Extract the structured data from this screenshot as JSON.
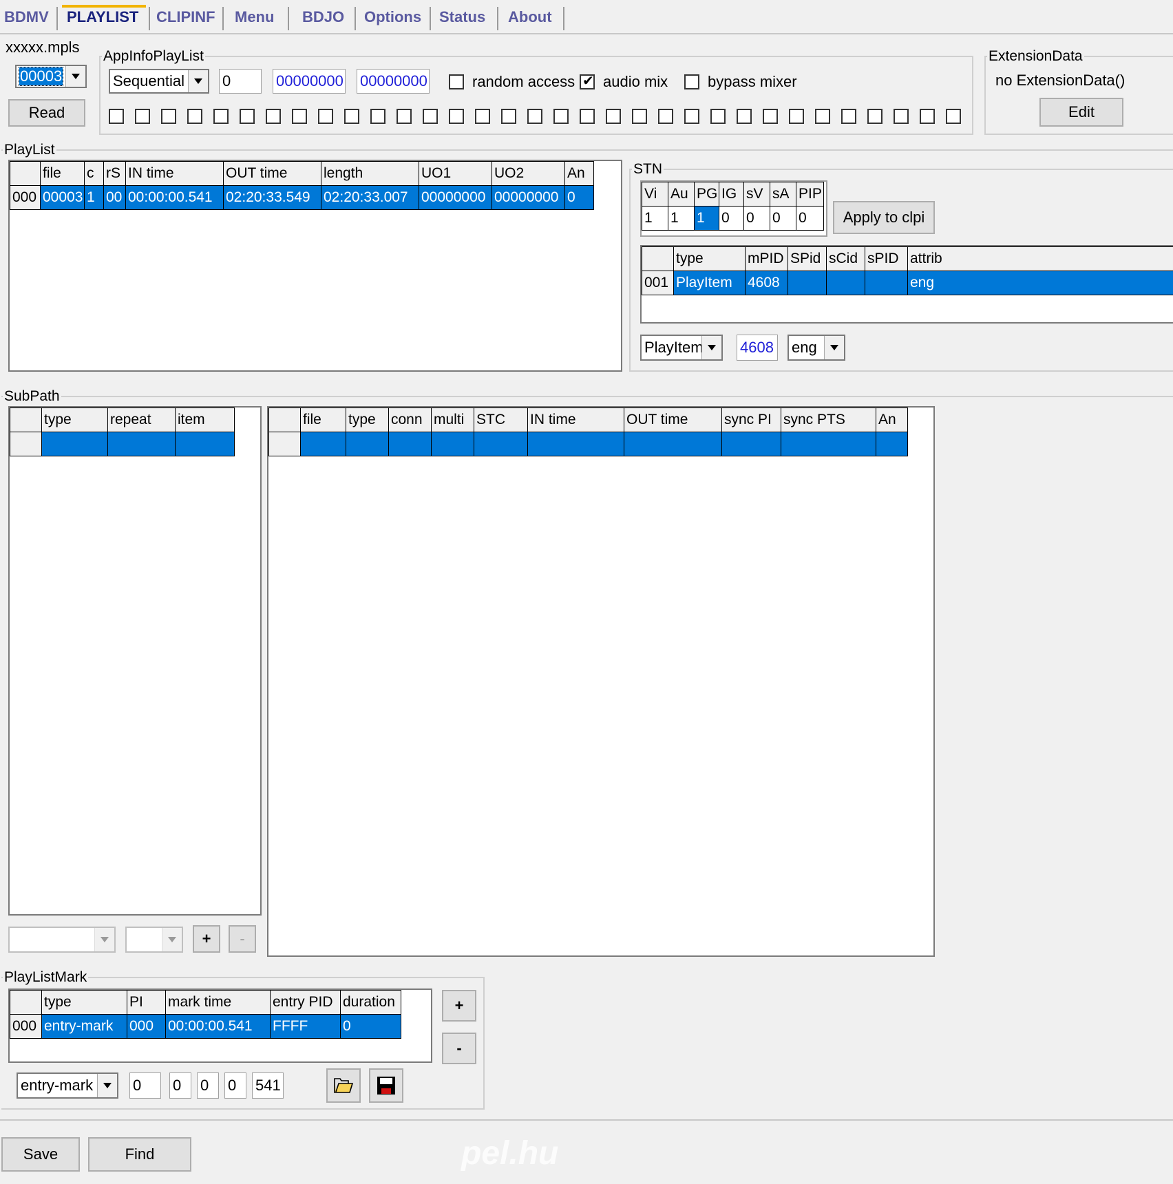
{
  "tabs": [
    {
      "label": "BDMV"
    },
    {
      "label": "PLAYLIST"
    },
    {
      "label": "CLIPINF"
    },
    {
      "label": "Menu"
    },
    {
      "label": "BDJO"
    },
    {
      "label": "Options"
    },
    {
      "label": "Status"
    },
    {
      "label": "About"
    }
  ],
  "mpls": {
    "legend": "xxxxx.mpls",
    "selected": "00003",
    "read_label": "Read"
  },
  "appinfo": {
    "legend": "AppInfoPlayList",
    "playback_type": "Sequential",
    "playback_count": "0",
    "uo1": "00000000",
    "uo2": "00000000",
    "random_access": {
      "label": "random access",
      "checked": false
    },
    "audio_mix": {
      "label": "audio mix",
      "checked": true
    },
    "bypass_mixer": {
      "label": "bypass mixer",
      "checked": false
    },
    "flag_count": 33
  },
  "extension": {
    "legend": "ExtensionData",
    "text": "no ExtensionData()",
    "edit_label": "Edit"
  },
  "playlist": {
    "legend": "PlayList",
    "columns": [
      "",
      "file",
      "c",
      "rS",
      "IN time",
      "OUT time",
      "length",
      "UO1",
      "UO2",
      "An"
    ],
    "rows": [
      [
        "000",
        "00003",
        "1",
        "00",
        "00:00:00.541",
        "02:20:33.549",
        "02:20:33.007",
        "00000000",
        "00000000",
        "0"
      ]
    ]
  },
  "stn": {
    "legend": "STN",
    "count_columns": [
      "Vi",
      "Au",
      "PG",
      "IG",
      "sV",
      "sA",
      "PIP"
    ],
    "count_values": [
      "1",
      "1",
      "1",
      "0",
      "0",
      "0",
      "0"
    ],
    "apply_label": "Apply to clpi",
    "stream_columns": [
      "",
      "type",
      "mPID",
      "SPid",
      "sCid",
      "sPID",
      "attrib"
    ],
    "stream_rows": [
      [
        "001",
        "PlayItem",
        "4608",
        "",
        "",
        "",
        "eng"
      ]
    ],
    "edit_type": "PlayItem",
    "edit_pid": "4608",
    "edit_lang": "eng"
  },
  "subpath": {
    "legend": "SubPath",
    "columns": [
      "",
      "type",
      "repeat",
      "item"
    ],
    "item_columns": [
      "",
      "file",
      "type",
      "conn",
      "multi",
      "STC",
      "IN time",
      "OUT time",
      "sync PI",
      "sync PTS",
      "An"
    ],
    "add_label": "+",
    "remove_label": "-"
  },
  "marks": {
    "legend": "PlayListMark",
    "columns": [
      "",
      "type",
      "PI",
      "mark time",
      "entry PID",
      "duration"
    ],
    "rows": [
      [
        "000",
        "entry-mark",
        "000",
        "00:00:00.541",
        "FFFF",
        "0"
      ]
    ],
    "add_label": "+",
    "remove_label": "-",
    "edit_type": "entry-mark",
    "edit_pi": "0",
    "edit_h": "0",
    "edit_m": "0",
    "edit_s": "0",
    "edit_ms": "541"
  },
  "footer": {
    "save_label": "Save",
    "find_label": "Find",
    "watermark": "pel.hu"
  },
  "colors": {
    "selection": "#0078d7",
    "tab_highlight": "#f2b400",
    "blue_text": "#1f1fd8"
  }
}
